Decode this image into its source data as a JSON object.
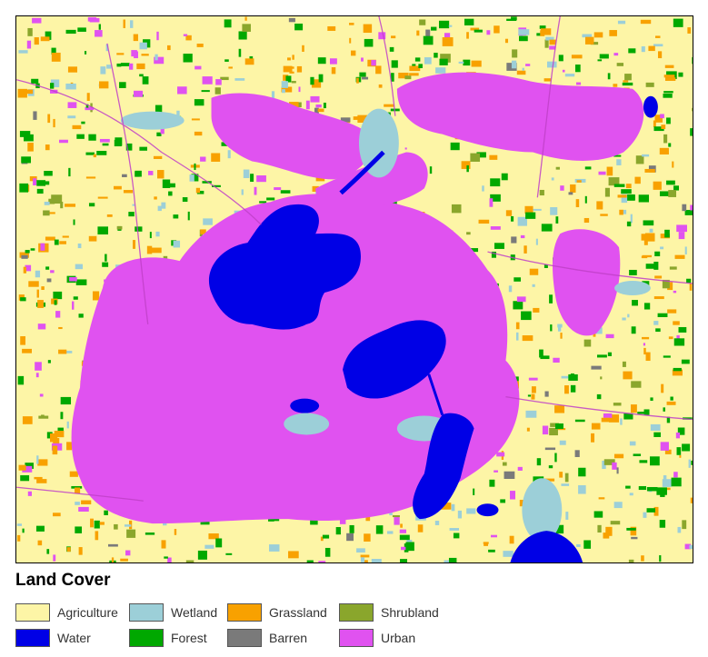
{
  "legend": {
    "title": "Land Cover",
    "items": [
      {
        "label": "Agriculture",
        "color": "#fdf5a6"
      },
      {
        "label": "Wetland",
        "color": "#9ccfd8"
      },
      {
        "label": "Grassland",
        "color": "#f8a100"
      },
      {
        "label": "Shrubland",
        "color": "#8aa62c"
      },
      {
        "label": "Water",
        "color": "#0000e6"
      },
      {
        "label": "Forest",
        "color": "#00a800"
      },
      {
        "label": "Barren",
        "color": "#7a7a7a"
      },
      {
        "label": "Urban",
        "color": "#e052f0"
      }
    ]
  }
}
